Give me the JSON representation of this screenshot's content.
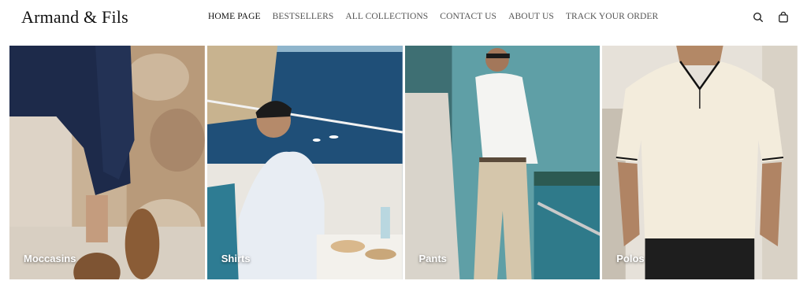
{
  "brand": {
    "name": "Armand & Fils"
  },
  "nav": {
    "items": [
      {
        "label": "HOME PAGE"
      },
      {
        "label": "BESTSELLERS"
      },
      {
        "label": "ALL COLLECTIONS"
      },
      {
        "label": "CONTACT US"
      },
      {
        "label": "ABOUT US"
      },
      {
        "label": "TRACK YOUR ORDER"
      }
    ],
    "active_index": 0
  },
  "header_icons": [
    "search-icon",
    "shopping-bag-icon"
  ],
  "categories": [
    {
      "label": "Moccasins"
    },
    {
      "label": "Shirts"
    },
    {
      "label": "Pants"
    },
    {
      "label": "Polos"
    }
  ],
  "colors": {
    "text": "#111111",
    "nav_text": "#555555",
    "label_text": "#ffffff",
    "background": "#ffffff"
  }
}
